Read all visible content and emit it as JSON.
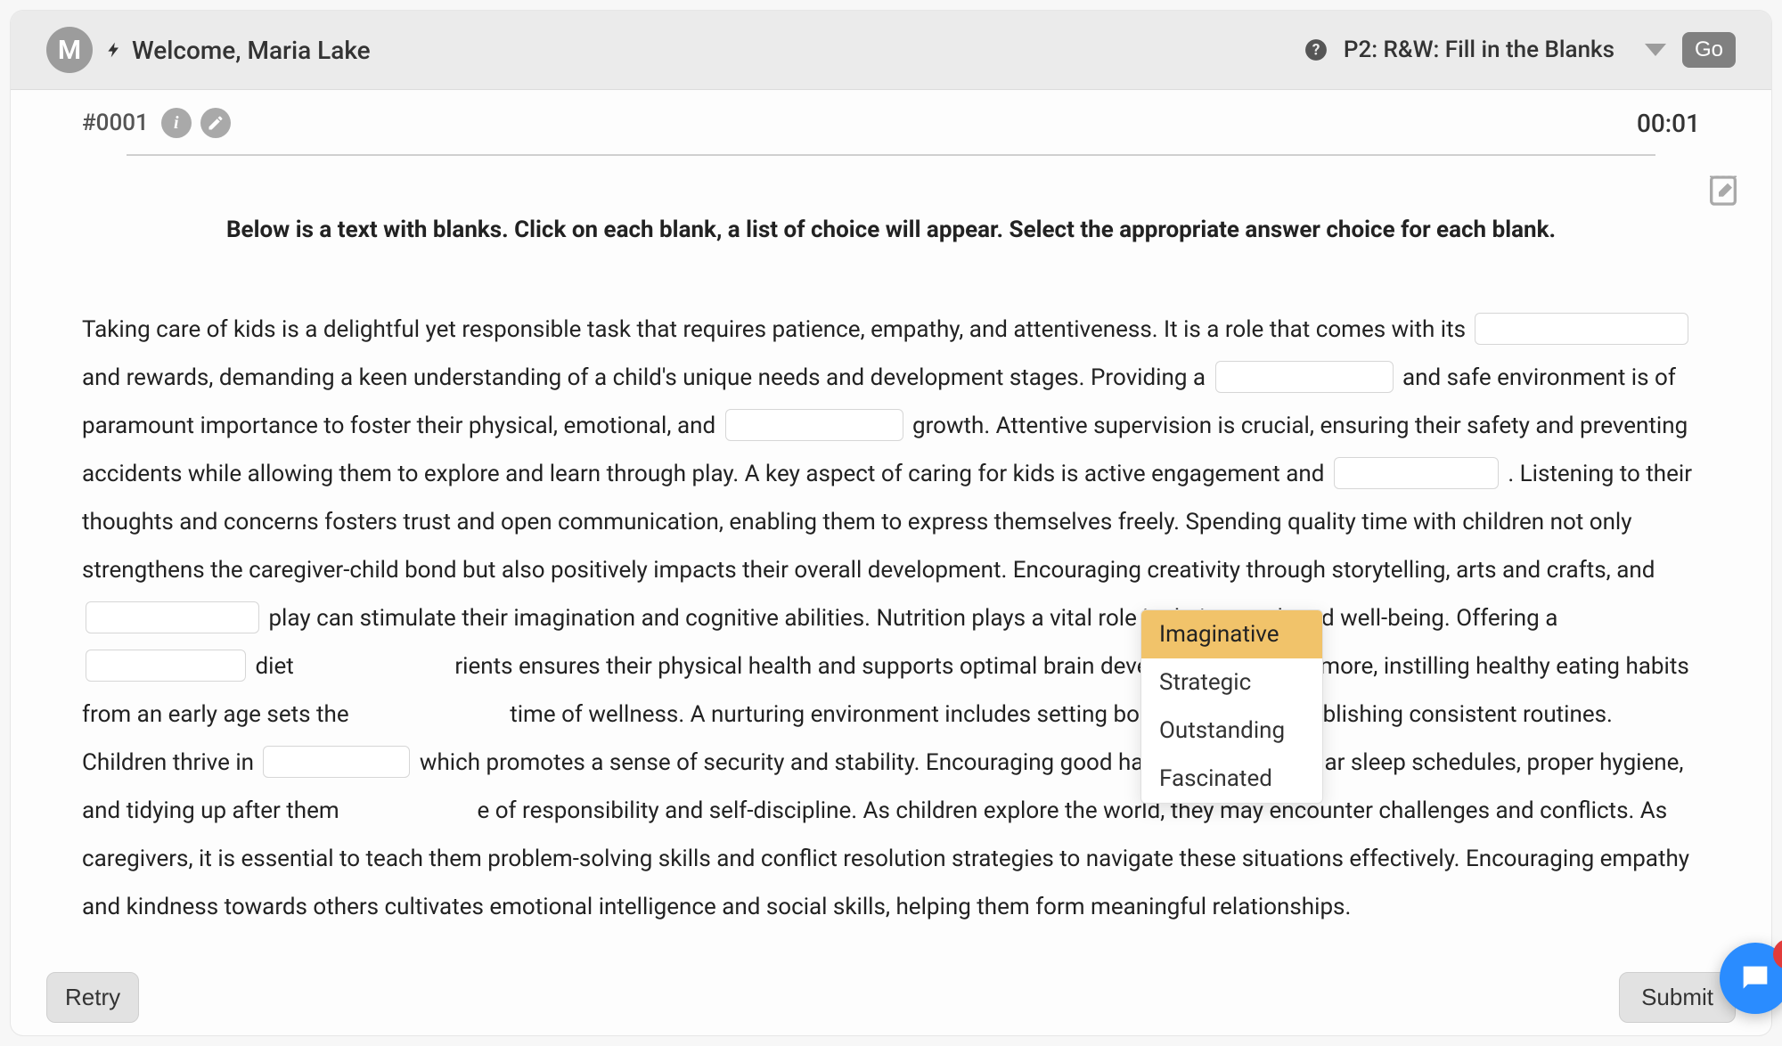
{
  "topbar": {
    "avatar_letter": "M",
    "welcome": "Welcome, Maria Lake",
    "selector": "P2: R&W: Fill in the Blanks",
    "go": "Go"
  },
  "subbar": {
    "qnum": "#0001",
    "timer": "00:01"
  },
  "instruction": "Below is a text with blanks. Click on each blank, a list of choice will appear. Select the appropriate answer choice for each blank.",
  "passage": {
    "s0": "Taking care of kids is a delightful yet responsible task that requires patience, empathy, and attentiveness. It is a role that comes with its ",
    "s1": " and rewards, demanding a keen understanding of a child's unique needs and development stages. Providing a ",
    "s2": " and safe environment is of paramount importance to foster their physical, emotional, and ",
    "s3": " growth. Attentive supervision is crucial, ensuring their safety and preventing accidents while allowing them to explore and learn through play. A key aspect of caring for kids is active engagement and ",
    "s4": " . Listening to their thoughts and concerns fosters trust and open communication, enabling them to express themselves freely. Spending quality time with children not only strengthens the caregiver-child bond but also positively impacts their overall development. Encouraging creativity through storytelling, arts and crafts, and ",
    "s5": " play can stimulate their imagination and cognitive abilities. Nutrition plays a vital role in their growth and well-being. Offering a ",
    "s6": " diet ",
    "s6b": "rients ensures their physical health and supports optimal brain development. Furthermore, instilling healthy eating habits from an early age sets the ",
    "s6c": "time of wellness. A nurturing environment includes setting boundaries and establishing consistent routines. Children thrive in ",
    "s7": "which promotes a sense of security and stability. Encouraging good habits such as regular sleep schedules, proper hygiene, and tidying up after them",
    "s7b": "e of responsibility and self-discipline. As children explore the world, they may encounter challenges and conflicts. As caregivers, it is essential to teach them problem-solving skills and conflict resolution strategies to navigate these situations effectively. Encouraging empathy and kindness towards others cultivates emotional intelligence and social skills, helping them form meaningful relationships."
  },
  "dropdown": {
    "options": [
      "Imaginative",
      "Strategic",
      "Outstanding",
      "Fascinated"
    ],
    "active_index": 0
  },
  "footer": {
    "retry": "Retry",
    "submit": "Submit"
  }
}
